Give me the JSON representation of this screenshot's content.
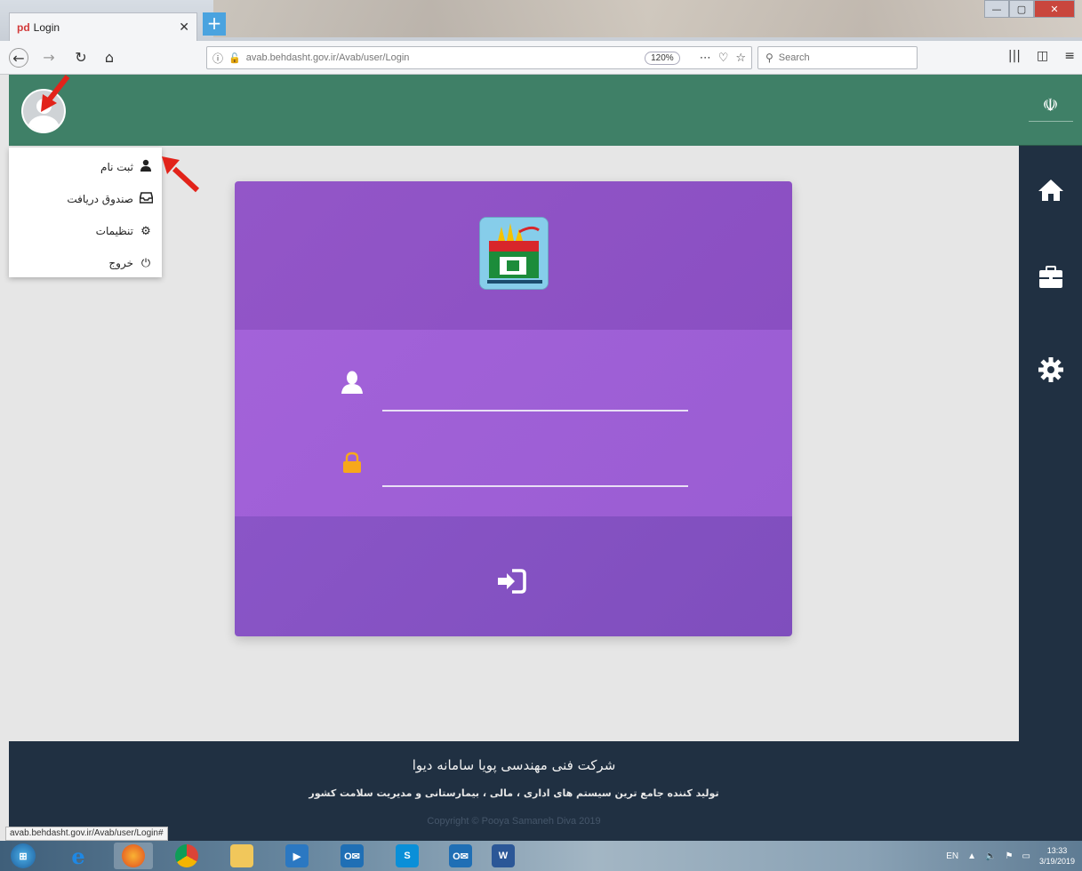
{
  "browser": {
    "tab_favicon": "pd",
    "tab_title": "Login",
    "new_tab": "+",
    "url": "avab.behdasht.gov.ir/Avab/user/Login",
    "zoom": "120%",
    "search_placeholder": "Search",
    "status_url": "avab.behdasht.gov.ir/Avab/user/Login#"
  },
  "user_menu": {
    "items": [
      {
        "label": "ثبت نام",
        "icon": "user-icon"
      },
      {
        "label": "صندوق دریافت",
        "icon": "inbox-icon"
      },
      {
        "label": "تنظیمات",
        "icon": "gear-icon"
      },
      {
        "label": "خروج",
        "icon": "power-icon"
      }
    ]
  },
  "sidebar": {
    "items": [
      {
        "icon": "home-icon"
      },
      {
        "icon": "briefcase-icon"
      },
      {
        "icon": "gear-icon"
      }
    ]
  },
  "login": {
    "username_value": "",
    "password_value": ""
  },
  "footer": {
    "company": "شرکت فنی مهندسی پویا سامانه دیوا",
    "tagline": "تولید کننده جامع ترین سیستم های اداری ، مالی ، بیمارستانی و مدیریت سلامت کشور",
    "copyright": "Copyright © Pooya Samaneh Diva 2019"
  },
  "taskbar": {
    "items": [
      "start",
      "ie",
      "firefox",
      "chrome",
      "explorer",
      "media",
      "outlook",
      "skype",
      "outlook",
      "word"
    ],
    "lang": "EN",
    "time": "13:33",
    "date": "3/19/2019"
  },
  "colors": {
    "header_green": "#3f8067",
    "sidebar_navy": "#203042",
    "card_purple": "#9a5dd3",
    "arrow_red": "#e2231a"
  }
}
